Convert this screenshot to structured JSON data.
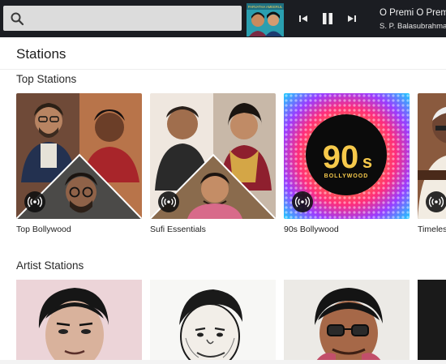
{
  "search": {
    "value": "",
    "placeholder": ""
  },
  "now_playing": {
    "title": "O Premi O Premi",
    "artist": "S. P. Balasubrahmanyam",
    "album_art_text": "PARVATHA AMEERUL",
    "controls": [
      "previous-icon",
      "pause-icon",
      "next-icon"
    ]
  },
  "page": {
    "title": "Stations"
  },
  "top_stations": {
    "heading": "Top Stations",
    "items": [
      {
        "label": "Top Bollywood"
      },
      {
        "label": "Sufi Essentials"
      },
      {
        "label": "90s Bollywood",
        "art_big": "90",
        "art_small": "s",
        "art_sub": "BOLLYWOOD"
      },
      {
        "label": "Timeless"
      }
    ]
  },
  "artist_stations": {
    "heading": "Artist Stations",
    "count_visible": 4
  },
  "colors": {
    "topbar": "#1b1d22",
    "search_bg": "#dcdcdc",
    "badge": "#0f0f0f",
    "text": "#222222"
  }
}
